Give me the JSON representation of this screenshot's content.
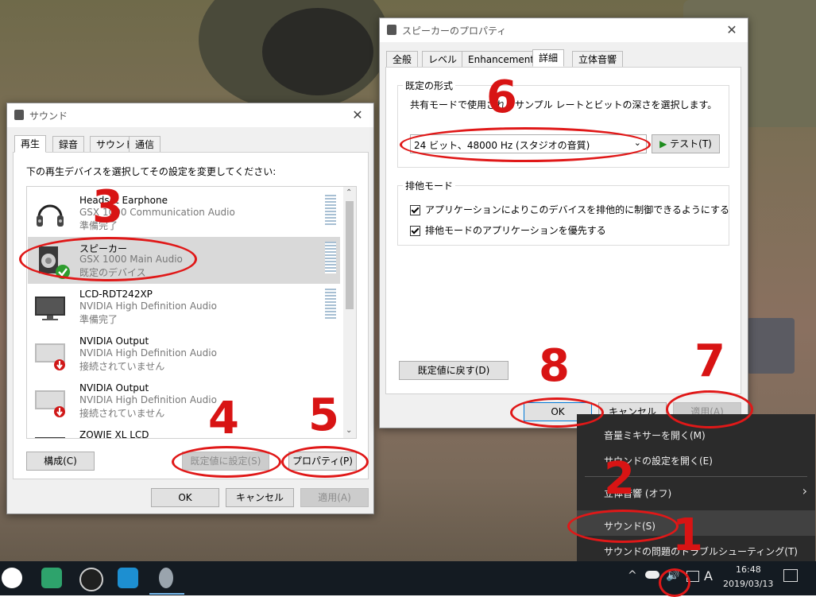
{
  "sound_window": {
    "title": "サウンド",
    "tabs": [
      "再生",
      "録音",
      "サウンド",
      "通信"
    ],
    "instruction": "下の再生デバイスを選択してその設定を変更してください:",
    "devices": [
      {
        "name": "Headset Earphone",
        "driver": "GSX 1000 Communication Audio",
        "status": "準備完了"
      },
      {
        "name": "スピーカー",
        "driver": "GSX 1000 Main Audio",
        "status": "既定のデバイス"
      },
      {
        "name": "LCD-RDT242XP",
        "driver": "NVIDIA High Definition Audio",
        "status": "準備完了"
      },
      {
        "name": "NVIDIA Output",
        "driver": "NVIDIA High Definition Audio",
        "status": "接続されていません"
      },
      {
        "name": "NVIDIA Output",
        "driver": "NVIDIA High Definition Audio",
        "status": "接続されていません"
      },
      {
        "name": "ZOWIE XL LCD",
        "driver": "",
        "status": ""
      }
    ],
    "configure_button": "構成(C)",
    "set_default_button": "既定値に設定(S)",
    "properties_button": "プロパティ(P)",
    "ok_button": "OK",
    "cancel_button": "キャンセル",
    "apply_button": "適用(A)"
  },
  "props_window": {
    "title": "スピーカーのプロパティ",
    "tabs": [
      "全般",
      "レベル",
      "Enhancements",
      "詳細",
      "立体音響"
    ],
    "default_format_legend": "既定の形式",
    "default_format_desc": "共有モードで使用されるサンプル レートとビットの深さを選択します。",
    "format_value": "24 ビット、48000 Hz (スタジオの音質)",
    "test_button": "テスト(T)",
    "exclusive_legend": "排他モード",
    "exclusive_option1": "アプリケーションによりこのデバイスを排他的に制御できるようにする",
    "exclusive_option2": "排他モードのアプリケーションを優先する",
    "restore_defaults_button": "既定値に戻す(D)",
    "ok_button": "OK",
    "cancel_button": "キャンセル",
    "apply_button": "適用(A)"
  },
  "context_menu": {
    "items": [
      "音量ミキサーを開く(M)",
      "サウンドの設定を開く(E)",
      "立体音響 (オフ)",
      "サウンド(S)",
      "サウンドの問題のトラブルシューティング(T)"
    ]
  },
  "taskbar": {
    "time": "16:48",
    "date": "2019/03/13",
    "ime": "A"
  },
  "annotations": [
    "1",
    "2",
    "3",
    "4",
    "5",
    "6",
    "7",
    "8"
  ],
  "colors": {
    "annotation": "#e01818",
    "accent": "#0078d7",
    "menu_bg": "#2b2b2b"
  }
}
